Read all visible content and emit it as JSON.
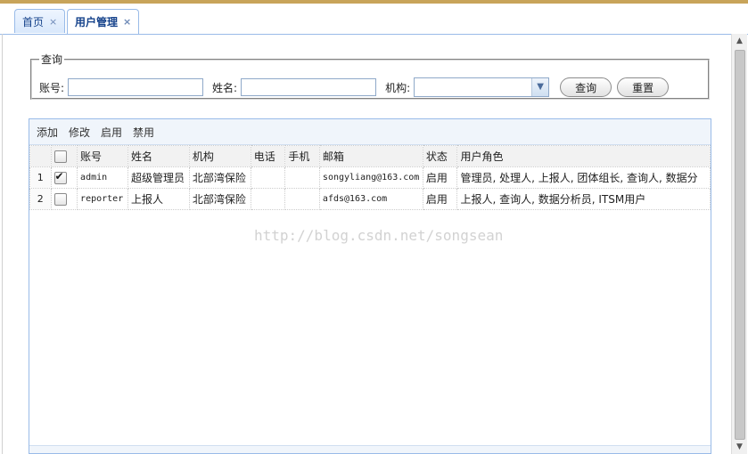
{
  "tabs": [
    {
      "label": "首页",
      "close": "×"
    },
    {
      "label": "用户管理",
      "close": "×"
    }
  ],
  "query": {
    "legend": "查询",
    "account_label": "账号:",
    "name_label": "姓名:",
    "org_label": "机构:",
    "account_value": "",
    "name_value": "",
    "org_value": "",
    "search_button": "查询",
    "reset_button": "重置"
  },
  "toolbar": {
    "add": "添加",
    "edit": "修改",
    "enable": "启用",
    "disable": "禁用"
  },
  "columns": [
    "账号",
    "姓名",
    "机构",
    "电话",
    "手机",
    "邮箱",
    "状态",
    "用户角色"
  ],
  "rows": [
    {
      "num": "1",
      "checked": true,
      "cells": [
        "admin",
        "超级管理员",
        "北部湾保险",
        "",
        "",
        "songyliang@163.com",
        "启用",
        "管理员, 处理人, 上报人, 团体组长, 查询人, 数据分"
      ]
    },
    {
      "num": "2",
      "checked": false,
      "cells": [
        "reporter",
        "上报人",
        "北部湾保险",
        "",
        "",
        "afds@163.com",
        "启用",
        "上报人, 查询人, 数据分析员, ITSM用户"
      ]
    }
  ],
  "watermark": "http://blog.csdn.net/songsean",
  "colors": {
    "accent": "#15428b",
    "border": "#99bbe8",
    "topbar": "#c8a45a"
  }
}
